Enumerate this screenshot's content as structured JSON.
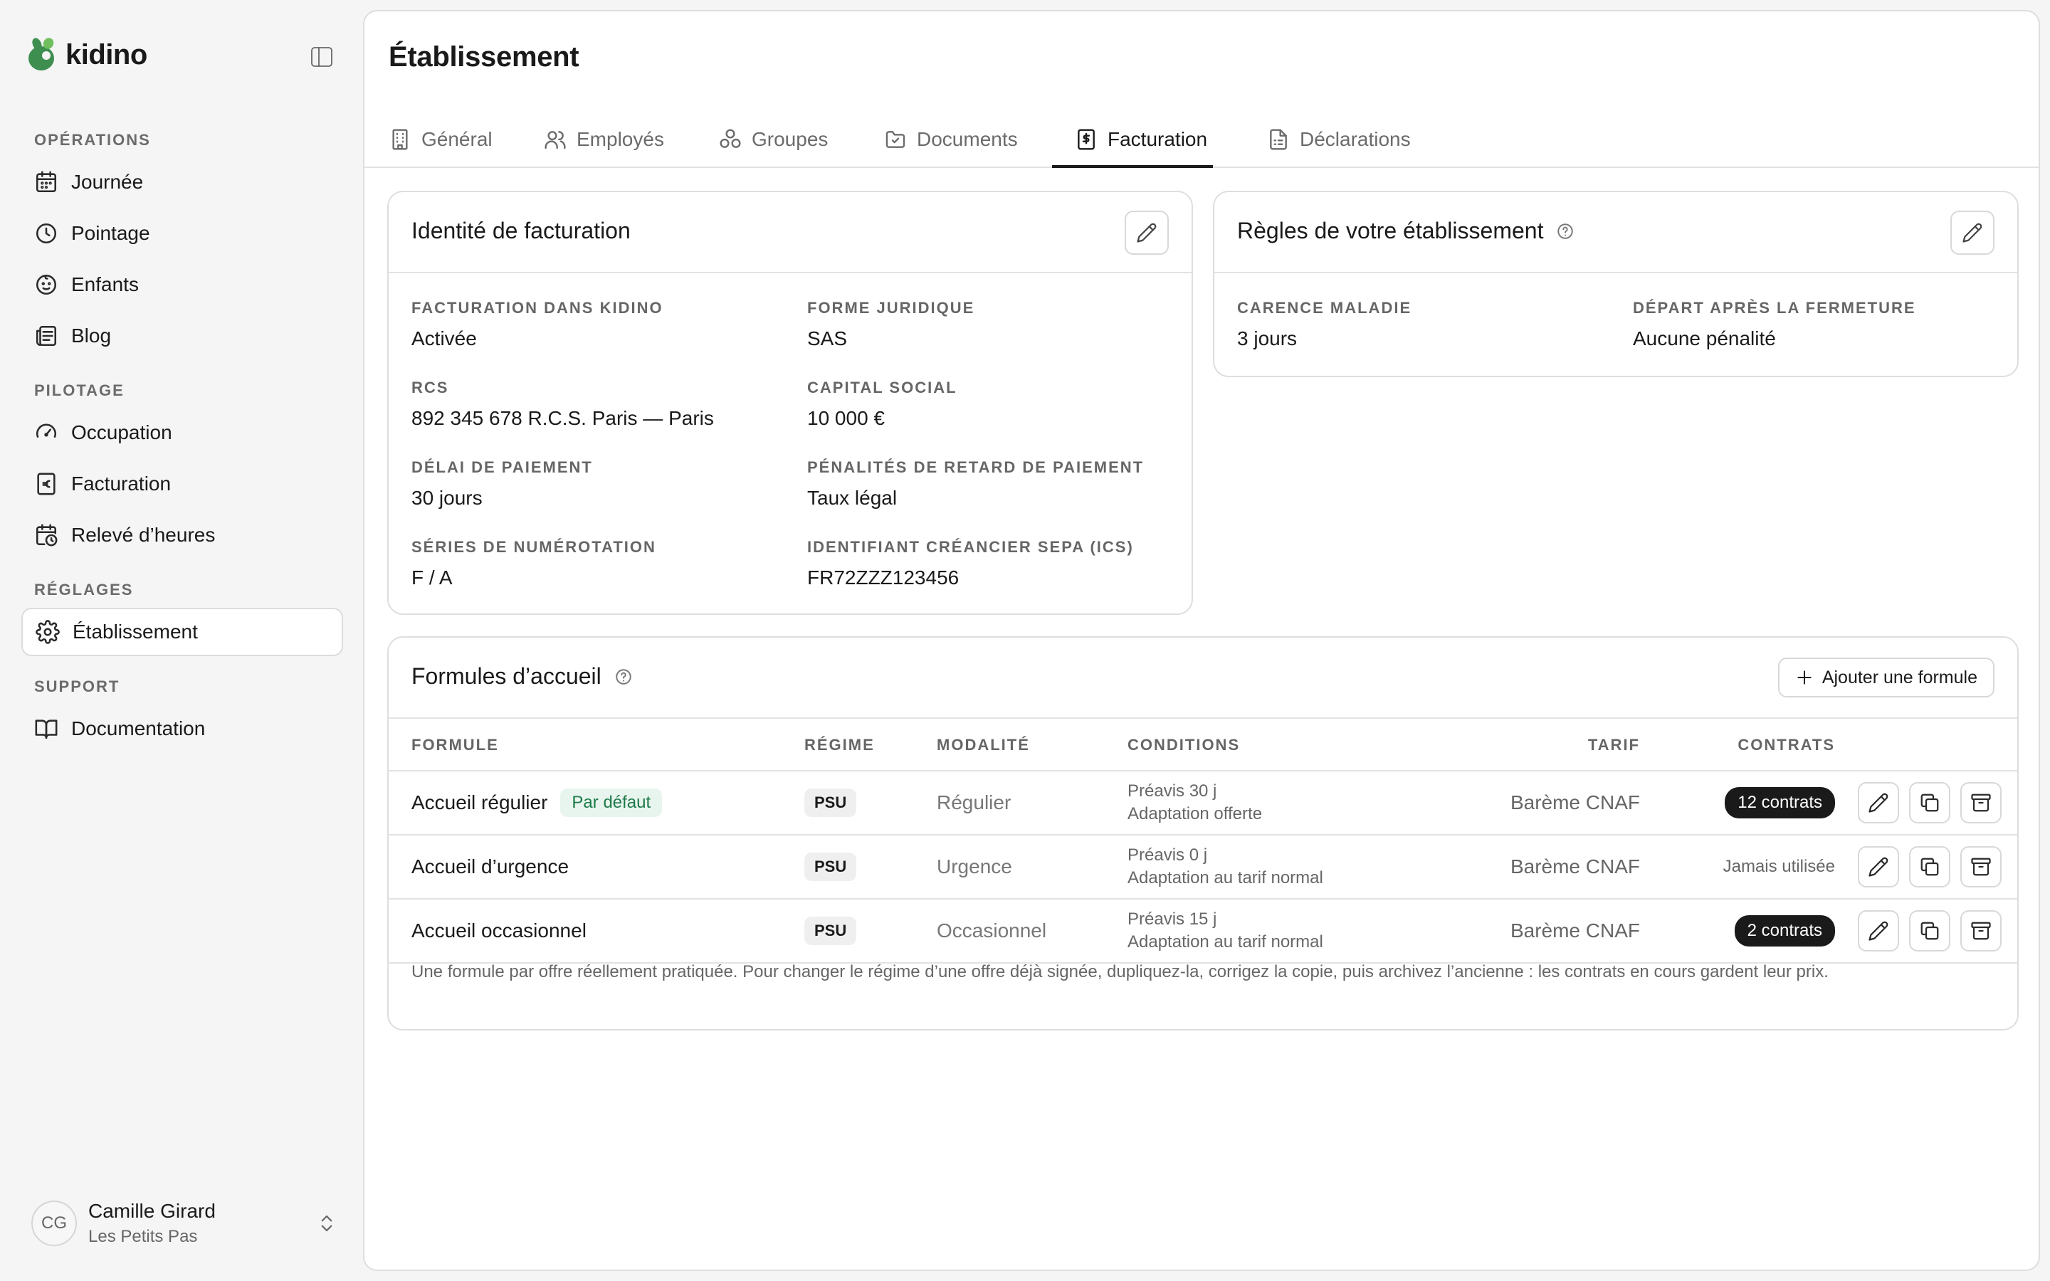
{
  "brand": {
    "name": "kidino",
    "logo_color": "#3e8e4f"
  },
  "sidebar": {
    "sections": [
      {
        "label": "OPÉRATIONS",
        "items": [
          {
            "label": "Journée",
            "icon": "calendar-icon"
          },
          {
            "label": "Pointage",
            "icon": "clock-icon"
          },
          {
            "label": "Enfants",
            "icon": "baby-icon"
          },
          {
            "label": "Blog",
            "icon": "newspaper-icon"
          }
        ]
      },
      {
        "label": "PILOTAGE",
        "items": [
          {
            "label": "Occupation",
            "icon": "gauge-icon"
          },
          {
            "label": "Facturation",
            "icon": "receipt-euro-icon"
          },
          {
            "label": "Relevé d’heures",
            "icon": "calendar-clock-icon"
          }
        ]
      },
      {
        "label": "RÉGLAGES",
        "items": [
          {
            "label": "Établissement",
            "icon": "gear-icon",
            "active": true
          }
        ]
      },
      {
        "label": "SUPPORT",
        "items": [
          {
            "label": "Documentation",
            "icon": "book-icon"
          }
        ]
      }
    ]
  },
  "user": {
    "initials": "CG",
    "name": "Camille Girard",
    "org": "Les Petits Pas"
  },
  "page": {
    "title": "Établissement"
  },
  "tabs": [
    {
      "label": "Général",
      "icon": "building-icon"
    },
    {
      "label": "Employés",
      "icon": "users-icon"
    },
    {
      "label": "Groupes",
      "icon": "groups-icon"
    },
    {
      "label": "Documents",
      "icon": "folder-icon"
    },
    {
      "label": "Facturation",
      "icon": "receipt-dollar-icon",
      "active": true
    },
    {
      "label": "Déclarations",
      "icon": "file-icon"
    }
  ],
  "billing_identity": {
    "title": "Identité de facturation",
    "fields": [
      {
        "label": "FACTURATION DANS KIDINO",
        "value": "Activée"
      },
      {
        "label": "FORME JURIDIQUE",
        "value": "SAS"
      },
      {
        "label": "RCS",
        "value": "892 345 678 R.C.S. Paris — Paris"
      },
      {
        "label": "CAPITAL SOCIAL",
        "value": "10 000 €"
      },
      {
        "label": "DÉLAI DE PAIEMENT",
        "value": "30 jours"
      },
      {
        "label": "PÉNALITÉS DE RETARD DE PAIEMENT",
        "value": "Taux légal"
      },
      {
        "label": "SÉRIES DE NUMÉROTATION",
        "value": "F / A"
      },
      {
        "label": "IDENTIFIANT CRÉANCIER SEPA (ICS)",
        "value": "FR72ZZZ123456"
      }
    ]
  },
  "rules": {
    "title": "Règles de votre établissement",
    "fields": [
      {
        "label": "CARENCE MALADIE",
        "value": "3 jours"
      },
      {
        "label": "DÉPART APRÈS LA FERMETURE",
        "value": "Aucune pénalité"
      }
    ]
  },
  "formulas": {
    "title": "Formules d’accueil",
    "add_label": "Ajouter une formule",
    "columns": [
      "FORMULE",
      "RÉGIME",
      "MODALITÉ",
      "CONDITIONS",
      "TARIF",
      "CONTRATS"
    ],
    "rows": [
      {
        "name": "Accueil régulier",
        "badge": "Par défaut",
        "regime": "PSU",
        "modalite": "Régulier",
        "cond1": "Préavis 30 j",
        "cond2": "Adaptation offerte",
        "tarif": "Barème CNAF",
        "contrats": "12 contrats",
        "used": true
      },
      {
        "name": "Accueil d’urgence",
        "badge": "",
        "regime": "PSU",
        "modalite": "Urgence",
        "cond1": "Préavis 0 j",
        "cond2": "Adaptation au tarif normal",
        "tarif": "Barème CNAF",
        "contrats": "Jamais utilisée",
        "used": false
      },
      {
        "name": "Accueil occasionnel",
        "badge": "",
        "regime": "PSU",
        "modalite": "Occasionnel",
        "cond1": "Préavis 15 j",
        "cond2": "Adaptation au tarif normal",
        "tarif": "Barème CNAF",
        "contrats": "2 contrats",
        "used": true
      }
    ],
    "footnote": "Une formule par offre réellement pratiquée. Pour changer le régime d’une offre déjà signée, dupliquez-la, corrigez la copie, puis archivez l’ancienne : les contrats en cours gardent leur prix."
  }
}
